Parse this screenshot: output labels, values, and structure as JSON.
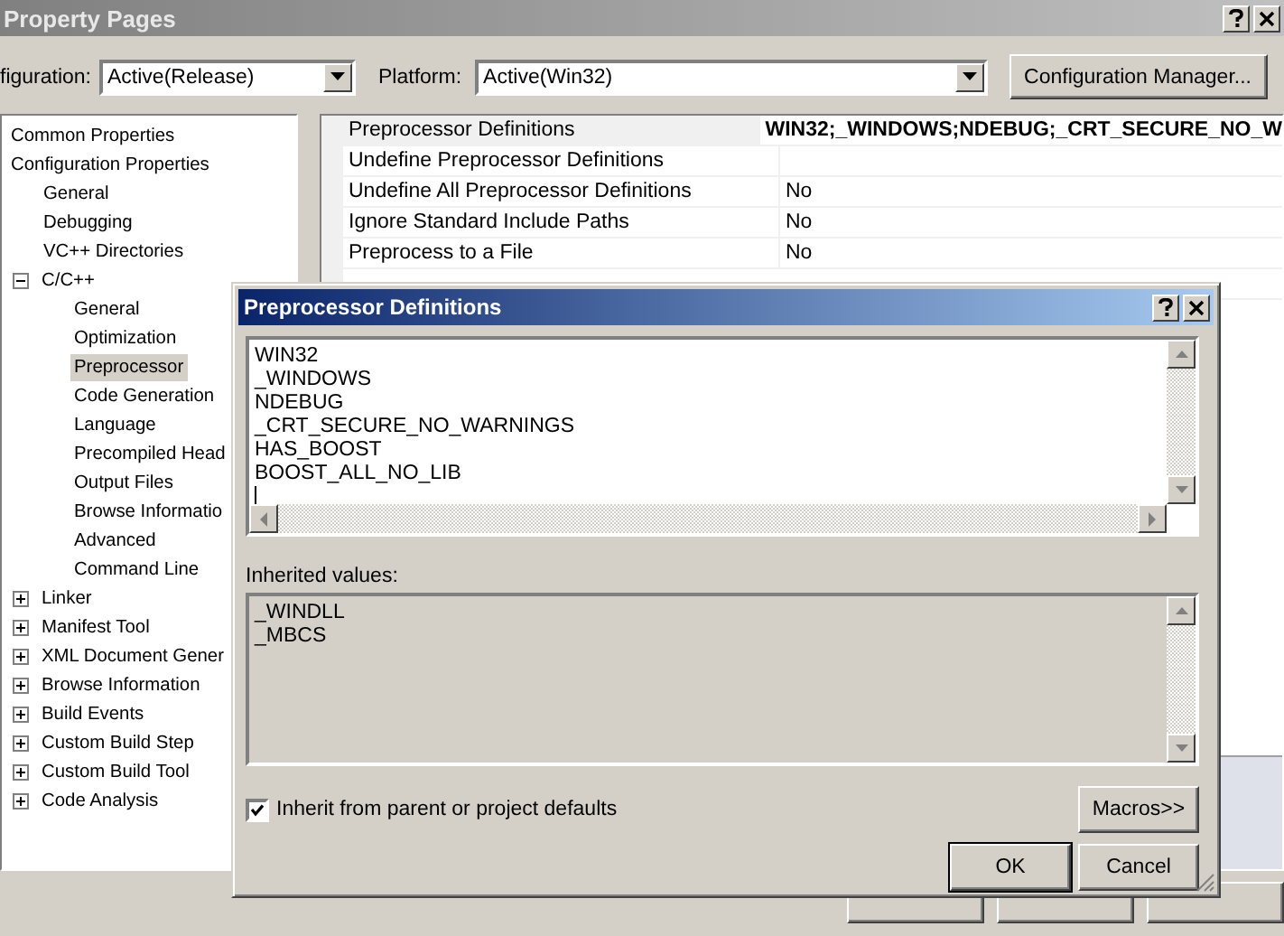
{
  "window": {
    "title": "Property Pages"
  },
  "toolbar": {
    "configuration_label": "figuration:",
    "configuration": "Active(Release)",
    "platform_label": "Platform:",
    "platform": "Active(Win32)",
    "manager_button": "Configuration Manager..."
  },
  "tree": [
    {
      "label": "Common Properties",
      "selected": false
    },
    {
      "label": "Configuration Properties",
      "selected": false,
      "children": [
        {
          "label": "General",
          "selected": false
        },
        {
          "label": "Debugging",
          "selected": false
        },
        {
          "label": "VC++ Directories",
          "selected": false
        },
        {
          "label": "C/C++",
          "selected": false,
          "expanded": true,
          "children": [
            {
              "label": "General",
              "selected": false
            },
            {
              "label": "Optimization",
              "selected": false
            },
            {
              "label": "Preprocessor",
              "selected": true
            },
            {
              "label": "Code Generation",
              "selected": false
            },
            {
              "label": "Language",
              "selected": false
            },
            {
              "label": "Precompiled Head",
              "selected": false
            },
            {
              "label": "Output Files",
              "selected": false
            },
            {
              "label": "Browse Informatio",
              "selected": false
            },
            {
              "label": "Advanced",
              "selected": false
            },
            {
              "label": "Command Line",
              "selected": false
            }
          ]
        },
        {
          "label": "Linker",
          "selected": false,
          "expanded": false
        },
        {
          "label": "Manifest Tool",
          "selected": false,
          "expanded": false
        },
        {
          "label": "XML Document Gener",
          "selected": false,
          "expanded": false
        },
        {
          "label": "Browse Information",
          "selected": false,
          "expanded": false
        },
        {
          "label": "Build Events",
          "selected": false,
          "expanded": false
        },
        {
          "label": "Custom Build Step",
          "selected": false,
          "expanded": false
        },
        {
          "label": "Custom Build Tool",
          "selected": false,
          "expanded": false
        },
        {
          "label": "Code Analysis",
          "selected": false,
          "expanded": false
        }
      ]
    }
  ],
  "grid": {
    "rows": [
      {
        "name": "Preprocessor Definitions",
        "value": "WIN32;_WINDOWS;NDEBUG;_CRT_SECURE_NO_W",
        "modified": true,
        "selected": true
      },
      {
        "name": "Undefine Preprocessor Definitions",
        "selected": false
      },
      {
        "name": "Undefine All Preprocessor Definitions",
        "value": "No",
        "modified": false,
        "selected": false
      },
      {
        "name": "Ignore Standard Include Paths",
        "value": "No",
        "modified": false,
        "selected": false
      },
      {
        "name": "Preprocess to a File",
        "value": "No",
        "modified": false,
        "selected": false
      }
    ]
  },
  "dialog": {
    "title": "Preprocessor Definitions",
    "definitions": [
      "WIN32",
      "_WINDOWS",
      "NDEBUG",
      "_CRT_SECURE_NO_WARNINGS",
      "HAS_BOOST",
      "BOOST_ALL_NO_LIB"
    ],
    "inherited_label": "Inherited values:",
    "inherited": [
      "_WINDLL",
      "_MBCS"
    ],
    "inherit_checkbox": {
      "label": "Inherit from parent or project defaults",
      "checked": true
    },
    "macros_button": "Macros>>",
    "ok_button": "OK",
    "cancel_button": "Cancel"
  }
}
